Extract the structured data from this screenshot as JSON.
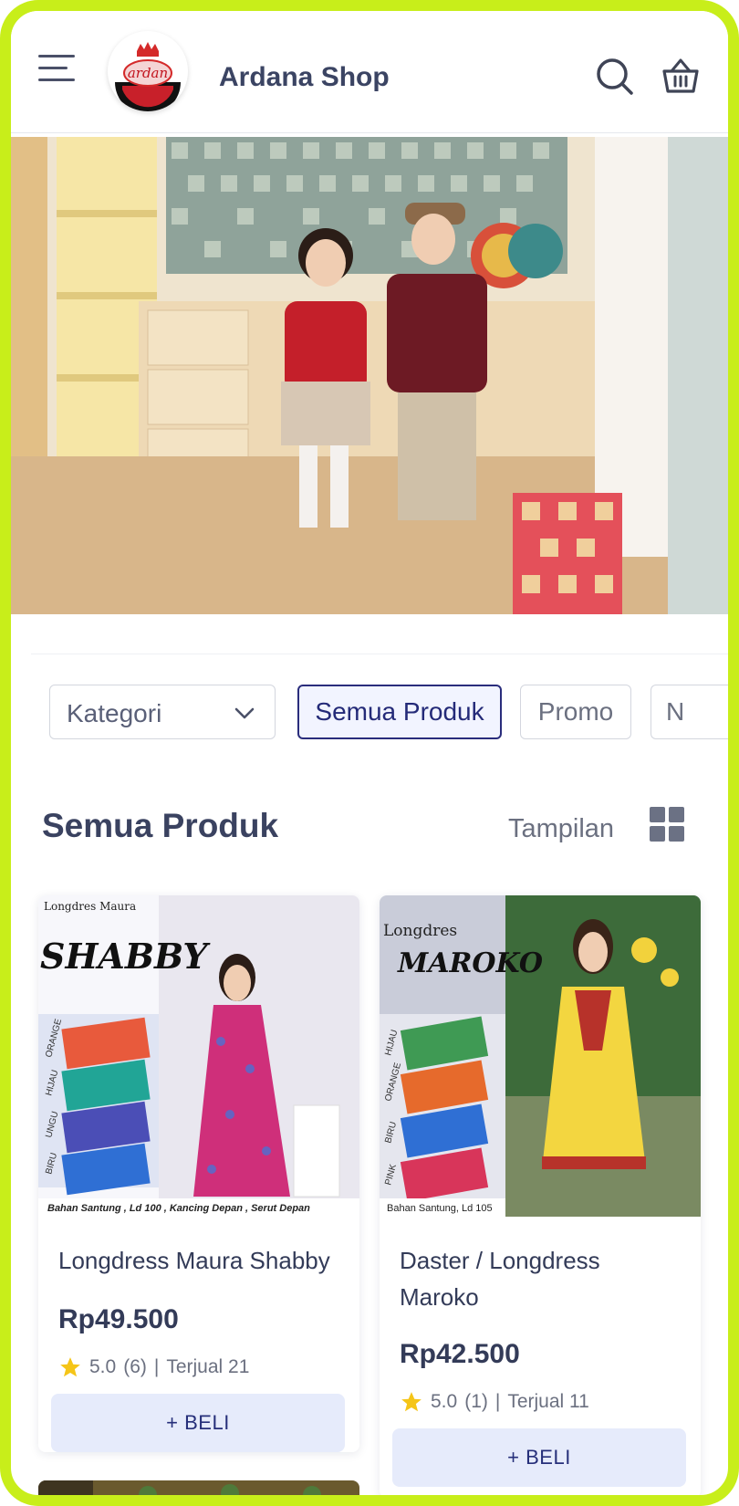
{
  "header": {
    "shop_name": "Ardana Shop",
    "logo_text": "ardan"
  },
  "icons": {
    "menu": "hamburger-menu-icon",
    "search": "search-icon",
    "cart": "basket-icon",
    "view": "grid-view-icon",
    "dropdown": "chevron-down-icon",
    "rating": "star-icon"
  },
  "filters": {
    "category_select": "Kategori",
    "chips": [
      "Semua Produk",
      "Promo",
      "N"
    ]
  },
  "section": {
    "title": "Semua Produk",
    "view_label": "Tampilan"
  },
  "products": [
    {
      "name": "Longdress Maura Shabby",
      "price": "Rp49.500",
      "rating": "5.0",
      "reviews": "(6)",
      "sold": "Terjual 21",
      "buy_label": "+ BELI",
      "image_caption_top": "Longdres Maura",
      "image_caption_title": "SHABBY",
      "image_colors": [
        "ORANGE",
        "HIJAU",
        "UNGU",
        "BIRU"
      ],
      "image_caption_bottom": "Bahan Santung , Ld 100 , Kancing Depan , Serut Depan"
    },
    {
      "name": "Daster / Longdress Maroko",
      "price": "Rp42.500",
      "rating": "5.0",
      "reviews": "(1)",
      "sold": "Terjual 11",
      "buy_label": "+ BELI",
      "image_caption_top": "Longdres",
      "image_caption_title": "MAROKO",
      "image_colors": [
        "HIJAU",
        "ORANGE",
        "BIRU",
        "PINK"
      ],
      "image_caption_bottom": "Bahan Santung, Ld 105"
    }
  ],
  "colors": {
    "frame": "#c8ee1a",
    "accent": "#242a78",
    "button_bg": "#e6ebfb",
    "star": "#f5c518"
  }
}
